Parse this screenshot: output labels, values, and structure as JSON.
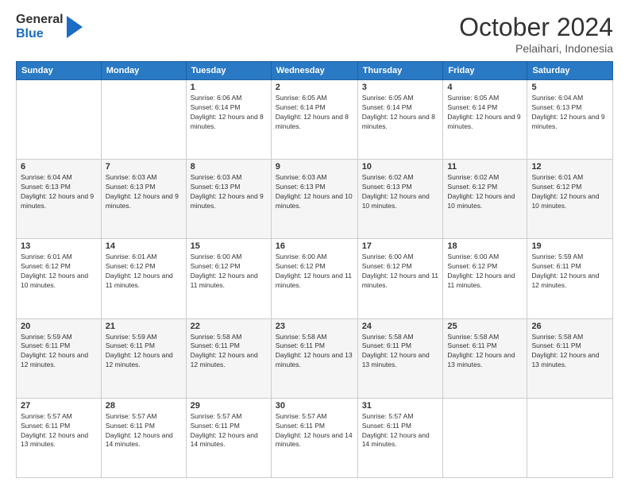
{
  "logo": {
    "general": "General",
    "blue": "Blue"
  },
  "header": {
    "month": "October 2024",
    "location": "Pelaihari, Indonesia"
  },
  "weekdays": [
    "Sunday",
    "Monday",
    "Tuesday",
    "Wednesday",
    "Thursday",
    "Friday",
    "Saturday"
  ],
  "weeks": [
    [
      null,
      null,
      {
        "day": "1",
        "sunrise": "6:06 AM",
        "sunset": "6:14 PM",
        "daylight": "12 hours and 8 minutes."
      },
      {
        "day": "2",
        "sunrise": "6:05 AM",
        "sunset": "6:14 PM",
        "daylight": "12 hours and 8 minutes."
      },
      {
        "day": "3",
        "sunrise": "6:05 AM",
        "sunset": "6:14 PM",
        "daylight": "12 hours and 8 minutes."
      },
      {
        "day": "4",
        "sunrise": "6:05 AM",
        "sunset": "6:14 PM",
        "daylight": "12 hours and 9 minutes."
      },
      {
        "day": "5",
        "sunrise": "6:04 AM",
        "sunset": "6:13 PM",
        "daylight": "12 hours and 9 minutes."
      }
    ],
    [
      {
        "day": "6",
        "sunrise": "6:04 AM",
        "sunset": "6:13 PM",
        "daylight": "12 hours and 9 minutes."
      },
      {
        "day": "7",
        "sunrise": "6:03 AM",
        "sunset": "6:13 PM",
        "daylight": "12 hours and 9 minutes."
      },
      {
        "day": "8",
        "sunrise": "6:03 AM",
        "sunset": "6:13 PM",
        "daylight": "12 hours and 9 minutes."
      },
      {
        "day": "9",
        "sunrise": "6:03 AM",
        "sunset": "6:13 PM",
        "daylight": "12 hours and 10 minutes."
      },
      {
        "day": "10",
        "sunrise": "6:02 AM",
        "sunset": "6:13 PM",
        "daylight": "12 hours and 10 minutes."
      },
      {
        "day": "11",
        "sunrise": "6:02 AM",
        "sunset": "6:12 PM",
        "daylight": "12 hours and 10 minutes."
      },
      {
        "day": "12",
        "sunrise": "6:01 AM",
        "sunset": "6:12 PM",
        "daylight": "12 hours and 10 minutes."
      }
    ],
    [
      {
        "day": "13",
        "sunrise": "6:01 AM",
        "sunset": "6:12 PM",
        "daylight": "12 hours and 10 minutes."
      },
      {
        "day": "14",
        "sunrise": "6:01 AM",
        "sunset": "6:12 PM",
        "daylight": "12 hours and 11 minutes."
      },
      {
        "day": "15",
        "sunrise": "6:00 AM",
        "sunset": "6:12 PM",
        "daylight": "12 hours and 11 minutes."
      },
      {
        "day": "16",
        "sunrise": "6:00 AM",
        "sunset": "6:12 PM",
        "daylight": "12 hours and 11 minutes."
      },
      {
        "day": "17",
        "sunrise": "6:00 AM",
        "sunset": "6:12 PM",
        "daylight": "12 hours and 11 minutes."
      },
      {
        "day": "18",
        "sunrise": "6:00 AM",
        "sunset": "6:12 PM",
        "daylight": "12 hours and 11 minutes."
      },
      {
        "day": "19",
        "sunrise": "5:59 AM",
        "sunset": "6:11 PM",
        "daylight": "12 hours and 12 minutes."
      }
    ],
    [
      {
        "day": "20",
        "sunrise": "5:59 AM",
        "sunset": "6:11 PM",
        "daylight": "12 hours and 12 minutes."
      },
      {
        "day": "21",
        "sunrise": "5:59 AM",
        "sunset": "6:11 PM",
        "daylight": "12 hours and 12 minutes."
      },
      {
        "day": "22",
        "sunrise": "5:58 AM",
        "sunset": "6:11 PM",
        "daylight": "12 hours and 12 minutes."
      },
      {
        "day": "23",
        "sunrise": "5:58 AM",
        "sunset": "6:11 PM",
        "daylight": "12 hours and 13 minutes."
      },
      {
        "day": "24",
        "sunrise": "5:58 AM",
        "sunset": "6:11 PM",
        "daylight": "12 hours and 13 minutes."
      },
      {
        "day": "25",
        "sunrise": "5:58 AM",
        "sunset": "6:11 PM",
        "daylight": "12 hours and 13 minutes."
      },
      {
        "day": "26",
        "sunrise": "5:58 AM",
        "sunset": "6:11 PM",
        "daylight": "12 hours and 13 minutes."
      }
    ],
    [
      {
        "day": "27",
        "sunrise": "5:57 AM",
        "sunset": "6:11 PM",
        "daylight": "12 hours and 13 minutes."
      },
      {
        "day": "28",
        "sunrise": "5:57 AM",
        "sunset": "6:11 PM",
        "daylight": "12 hours and 14 minutes."
      },
      {
        "day": "29",
        "sunrise": "5:57 AM",
        "sunset": "6:11 PM",
        "daylight": "12 hours and 14 minutes."
      },
      {
        "day": "30",
        "sunrise": "5:57 AM",
        "sunset": "6:11 PM",
        "daylight": "12 hours and 14 minutes."
      },
      {
        "day": "31",
        "sunrise": "5:57 AM",
        "sunset": "6:11 PM",
        "daylight": "12 hours and 14 minutes."
      },
      null,
      null
    ]
  ]
}
